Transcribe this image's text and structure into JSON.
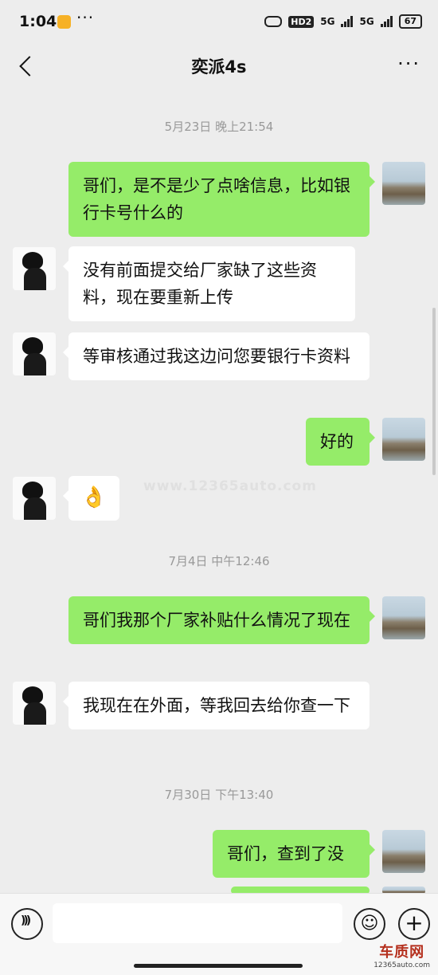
{
  "status_bar": {
    "time": "1:04",
    "more": "···",
    "hd": "HD2",
    "net1": "5G",
    "net2": "5G",
    "battery": "67"
  },
  "header": {
    "title": "奕派4s",
    "more": "···"
  },
  "messages": {
    "ts1": "5月23日 晚上21:54",
    "m1": "哥们，是不是少了点啥信息，比如银行卡号什么的",
    "m2": "没有前面提交给厂家缺了这些资料，现在要重新上传",
    "m3": "等审核通过我这边问您要银行卡资料",
    "m4": "好的",
    "m5": "👌",
    "ts2": "7月4日 中午12:46",
    "m6": "哥们我那个厂家补贴什么情况了现在",
    "m7": "我现在在外面，等我回去给你查一下",
    "ts3": "7月30日 下午13:40",
    "m8": "哥们，查到了没"
  },
  "watermark": "www.12365auto.com",
  "brand": {
    "name": "车质网",
    "url": "12365auto.com"
  },
  "colors": {
    "sent_bubble": "#95ec69",
    "received_bubble": "#ffffff",
    "background": "#ededed"
  }
}
